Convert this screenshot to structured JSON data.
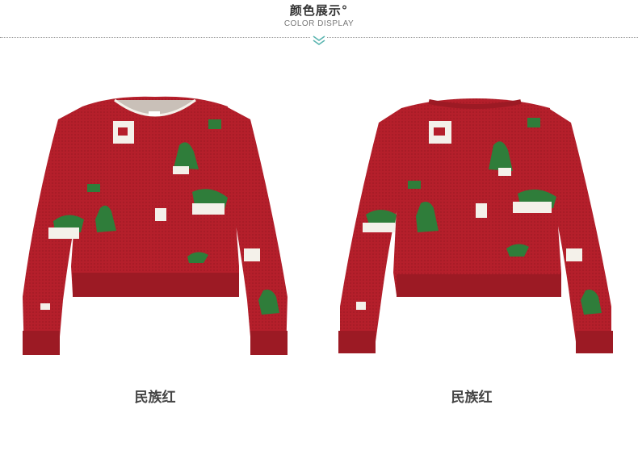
{
  "section": {
    "title": "颜色展示°",
    "subtitle": "COLOR DISPLAY",
    "divider_icon": "double-chevron-down-icon",
    "accent_color": "#5bb5b0"
  },
  "products": [
    {
      "view": "front",
      "color_name": "民族红",
      "image": "red-christmas-sweater-front-view"
    },
    {
      "view": "back",
      "color_name": "民族红",
      "image": "red-christmas-sweater-back-view"
    }
  ],
  "colors": {
    "sweater_red": "#b51f2b",
    "pattern_green": "#2f7d3a",
    "pattern_white": "#f4f1ea"
  }
}
